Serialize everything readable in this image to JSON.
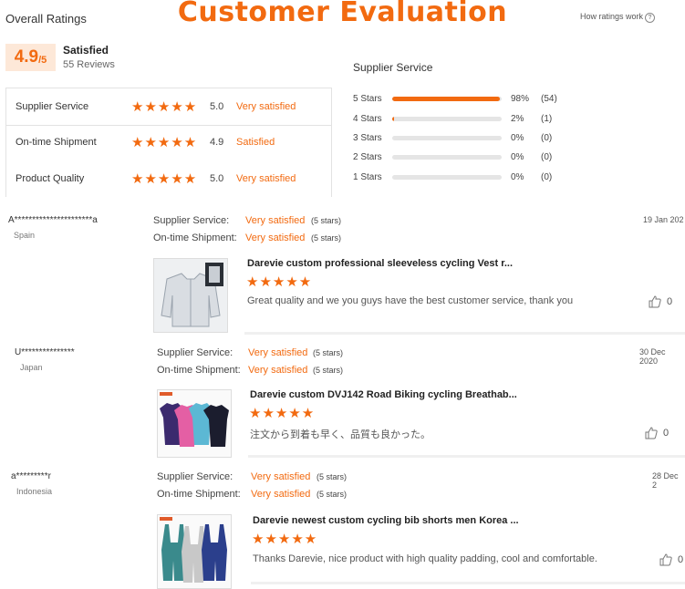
{
  "banner": "Customer Evaluation",
  "overall": {
    "title": "Overall Ratings",
    "how_link": "How ratings work",
    "score": "4.9",
    "score_max": "/5",
    "status": "Satisfied",
    "reviews": "55 Reviews"
  },
  "ratings": [
    {
      "label": "Supplier Service",
      "stars": "★★★★★",
      "score": "5.0",
      "desc": "Very satisfied"
    },
    {
      "label": "On-time Shipment",
      "stars": "★★★★★",
      "score": "4.9",
      "desc": "Satisfied"
    },
    {
      "label": "Product Quality",
      "stars": "★★★★★",
      "score": "5.0",
      "desc": "Very satisfied"
    }
  ],
  "distribution": {
    "title": "Supplier Service",
    "rows": [
      {
        "label": "5 Stars",
        "fraction": 0.98,
        "pct": "98%",
        "count": "(54)"
      },
      {
        "label": "4 Stars",
        "fraction": 0.02,
        "pct": "2%",
        "count": "(1)"
      },
      {
        "label": "3 Stars",
        "fraction": 0,
        "pct": "0%",
        "count": "(0)"
      },
      {
        "label": "2 Stars",
        "fraction": 0,
        "pct": "0%",
        "count": "(0)"
      },
      {
        "label": "1 Stars",
        "fraction": 0,
        "pct": "0%",
        "count": "(0)"
      }
    ]
  },
  "reviews": [
    {
      "name": "A**********************a",
      "country": "Spain",
      "date": "19 Jan 202",
      "supplier_label": "Supplier Service:",
      "supplier_value": "Very satisfied",
      "supplier_stars": "(5 stars)",
      "shipment_label": "On-time Shipment:",
      "shipment_value": "Very satisfied",
      "shipment_stars": "(5 stars)",
      "product_title": "Darevie custom professional sleeveless cycling Vest r...",
      "stars": "★★★★★",
      "text": "Great quality and we you guys have the best customer service, thank you",
      "likes": "0"
    },
    {
      "name": "U***************",
      "country": "Japan",
      "date": "30 Dec 2020",
      "supplier_label": "Supplier Service:",
      "supplier_value": "Very satisfied",
      "supplier_stars": "(5 stars)",
      "shipment_label": "On-time Shipment:",
      "shipment_value": "Very satisfied",
      "shipment_stars": "(5 stars)",
      "product_title": "Darevie custom DVJ142 Road Biking cycling Breathab...",
      "stars": "★★★★★",
      "text": "注文から到着も早く、品質も良かった。",
      "likes": "0"
    },
    {
      "name": "a*********r",
      "country": "Indonesia",
      "date": "28 Dec 2",
      "supplier_label": "Supplier Service:",
      "supplier_value": "Very satisfied",
      "supplier_stars": "(5 stars)",
      "shipment_label": "On-time Shipment:",
      "shipment_value": "Very satisfied",
      "shipment_stars": "(5 stars)",
      "product_title": "Darevie newest custom cycling bib shorts men Korea ...",
      "stars": "★★★★★",
      "text": "Thanks Darevie, nice product with high quality padding, cool and comfortable.",
      "likes": "0"
    }
  ],
  "colors": {
    "accent": "#f26a10",
    "accent_light": "#fde8d8",
    "bar_bg": "#e5e5e5"
  }
}
